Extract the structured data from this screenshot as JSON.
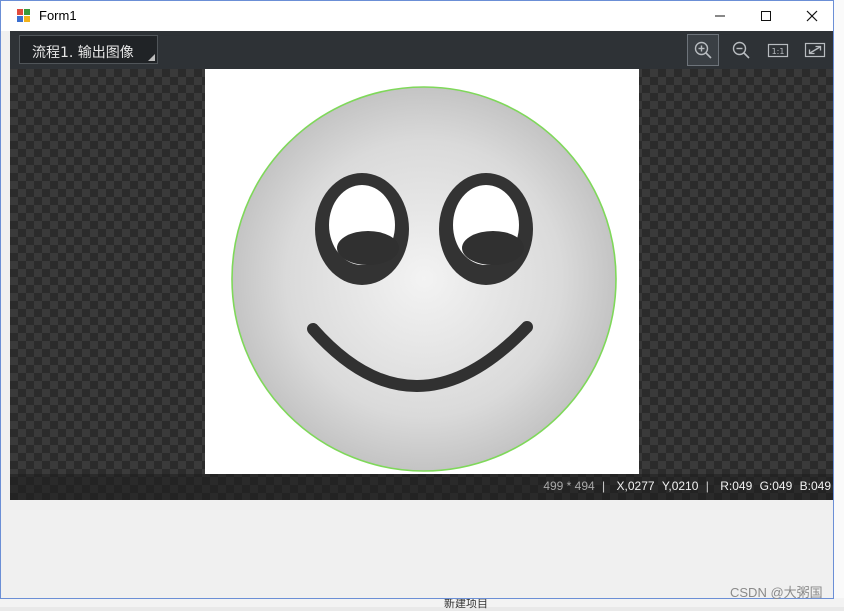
{
  "window": {
    "title": "Form1"
  },
  "toolbar": {
    "flow_selector": "流程1. 输出图像",
    "buttons": [
      "zoom-in",
      "zoom-out",
      "actual-size",
      "fit-to-window"
    ],
    "actual_size_label": "1:1"
  },
  "status": {
    "image_size": "499 * 494",
    "x": "X,0277",
    "y": "Y,0210",
    "r": "R:049",
    "g": "G:049",
    "b": "B:049"
  },
  "background": {
    "peek_text": "新建项目"
  },
  "watermark": "CSDN @大粥国",
  "colors": {
    "viewer_bg": "#353535",
    "toolbar_bg": "#2e3236",
    "circle_outline": "#7fd85a",
    "face_dark": "#313131"
  }
}
